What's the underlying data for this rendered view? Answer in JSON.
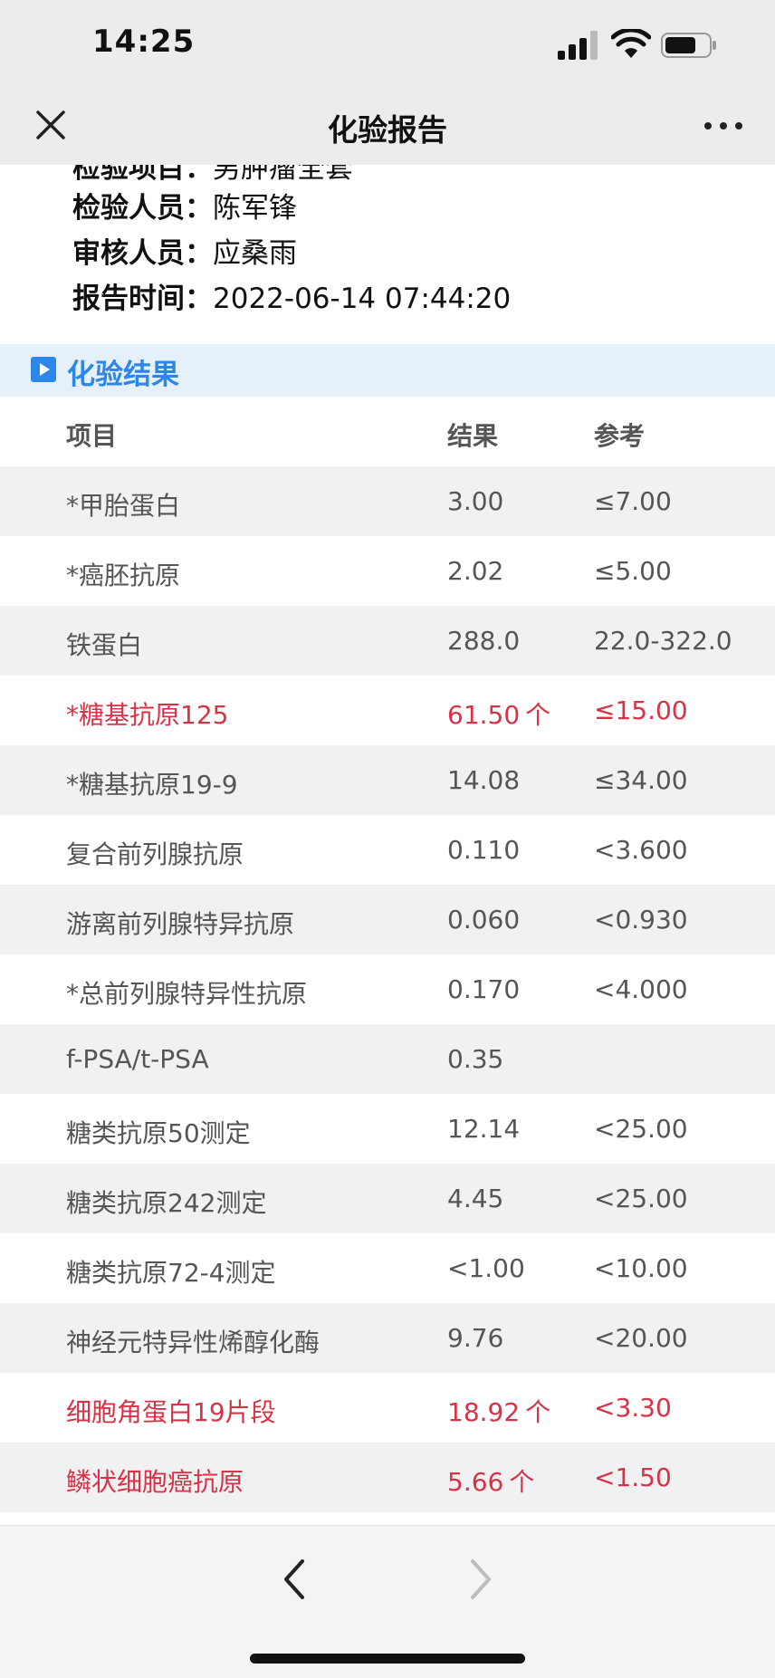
{
  "status_bar": {
    "time": "14:25"
  },
  "nav": {
    "title": "化验报告"
  },
  "info": [
    {
      "label": "检验项目：",
      "value": "男肿瘤全套"
    },
    {
      "label": "检验人员：",
      "value": "陈军锋"
    },
    {
      "label": "审核人员：",
      "value": "应桑雨"
    },
    {
      "label": "报告时间：",
      "value": "2022-06-14 07:44:20"
    }
  ],
  "section": {
    "title": "化验结果"
  },
  "table": {
    "headers": [
      "项目",
      "结果",
      "参考"
    ],
    "rows": [
      {
        "name": "*甲胎蛋白",
        "result": "3.00",
        "ref": "≤7.00",
        "flag": ""
      },
      {
        "name": "*癌胚抗原",
        "result": "2.02",
        "ref": "≤5.00",
        "flag": ""
      },
      {
        "name": "铁蛋白",
        "result": "288.0",
        "ref": "22.0-322.0",
        "flag": ""
      },
      {
        "name": "*糖基抗原125",
        "result": "61.50",
        "ref": "≤15.00",
        "flag": "个"
      },
      {
        "name": "*糖基抗原19-9",
        "result": "14.08",
        "ref": "≤34.00",
        "flag": ""
      },
      {
        "name": "复合前列腺抗原",
        "result": "0.110",
        "ref": "<3.600",
        "flag": ""
      },
      {
        "name": "游离前列腺特异抗原",
        "result": "0.060",
        "ref": "<0.930",
        "flag": ""
      },
      {
        "name": "*总前列腺特异性抗原",
        "result": "0.170",
        "ref": "<4.000",
        "flag": ""
      },
      {
        "name": "f-PSA/t-PSA",
        "result": "0.35",
        "ref": "",
        "flag": ""
      },
      {
        "name": "糖类抗原50测定",
        "result": "12.14",
        "ref": "<25.00",
        "flag": ""
      },
      {
        "name": "糖类抗原242测定",
        "result": "4.45",
        "ref": "<25.00",
        "flag": ""
      },
      {
        "name": "糖类抗原72-4测定",
        "result": "<1.00",
        "ref": "<10.00",
        "flag": ""
      },
      {
        "name": "神经元特异性烯醇化酶",
        "result": "9.76",
        "ref": "<20.00",
        "flag": ""
      },
      {
        "name": "细胞角蛋白19片段",
        "result": "18.92",
        "ref": "<3.30",
        "flag": "个"
      },
      {
        "name": "鳞状细胞癌抗原",
        "result": "5.66",
        "ref": "<1.50",
        "flag": "个"
      }
    ]
  },
  "colors": {
    "accent": "#2d87e8",
    "abnormal": "#d63446",
    "bar_bg": "#ececec",
    "alt_row": "#f1f1f3"
  },
  "icons": [
    "signal-icon",
    "wifi-icon",
    "battery-icon",
    "close-icon",
    "more-icon",
    "play-icon",
    "back-arrow-icon",
    "forward-arrow-icon"
  ]
}
